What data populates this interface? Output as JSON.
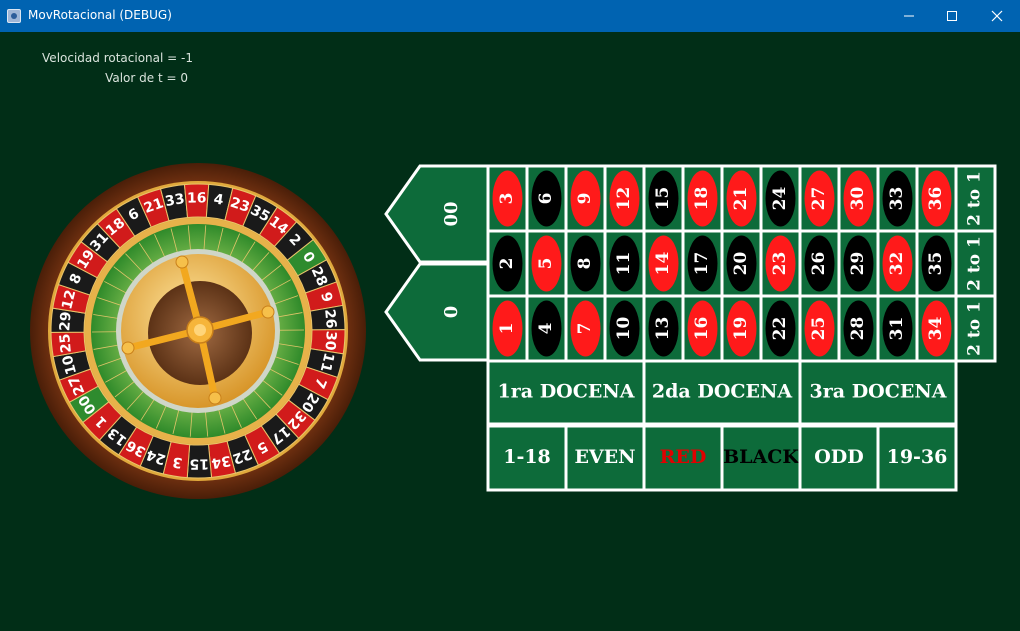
{
  "window": {
    "title": "MovRotacional (DEBUG)",
    "controls": [
      "minimize",
      "maximize",
      "close"
    ]
  },
  "info": {
    "velocity_label": "Velocidad rotacional = -1",
    "time_label": "Valor de t = 0"
  },
  "wheel": {
    "sequence": [
      "0",
      "28",
      "9",
      "26",
      "30",
      "11",
      "7",
      "20",
      "32",
      "17",
      "5",
      "22",
      "34",
      "15",
      "3",
      "24",
      "36",
      "13",
      "1",
      "00",
      "27",
      "10",
      "25",
      "29",
      "12",
      "8",
      "19",
      "31",
      "18",
      "6",
      "21",
      "33",
      "16",
      "4",
      "23",
      "35",
      "14",
      "2"
    ],
    "reds": [
      "1",
      "3",
      "5",
      "7",
      "9",
      "12",
      "14",
      "16",
      "18",
      "19",
      "21",
      "23",
      "25",
      "27",
      "30",
      "32",
      "34",
      "36"
    ],
    "colors": {
      "red": "#d11b1b",
      "black": "#1a1a1a",
      "green": "#2e8b2e",
      "wood": "#6b2e10",
      "gold": "#e9b949"
    }
  },
  "board": {
    "zeros": [
      "00",
      "0"
    ],
    "rows": [
      [
        "3",
        "6",
        "9",
        "12",
        "15",
        "18",
        "21",
        "24",
        "27",
        "30",
        "33",
        "36"
      ],
      [
        "2",
        "5",
        "8",
        "11",
        "14",
        "17",
        "20",
        "23",
        "26",
        "29",
        "32",
        "35"
      ],
      [
        "1",
        "4",
        "7",
        "10",
        "13",
        "16",
        "19",
        "22",
        "25",
        "28",
        "31",
        "34"
      ]
    ],
    "column_bets": [
      "2 to 1",
      "2 to 1",
      "2 to 1"
    ],
    "dozens": [
      "1ra DOCENA",
      "2da DOCENA",
      "3ra DOCENA"
    ],
    "outside": [
      "1-18",
      "EVEN",
      "RED",
      "BLACK",
      "ODD",
      "19-36"
    ],
    "colors": {
      "felt": "#0d6b3a",
      "line": "#ffffff",
      "red": "#ff1a1a",
      "black": "#000000"
    }
  }
}
